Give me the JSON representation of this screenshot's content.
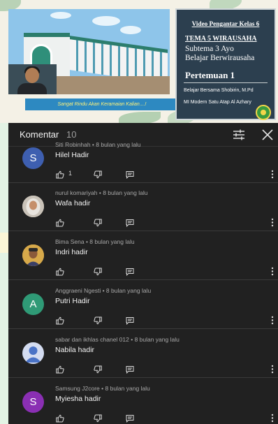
{
  "video": {
    "caption": "Sangat Rindu Akan Keramaian Kalian....!",
    "slide": {
      "title": "Video Pengantar Kelas 6",
      "tema": "TEMA 5 WIRAUSAHA",
      "subtema_line1": "Subtema 3 Ayo",
      "subtema_line2": "Belajar Berwirausaha",
      "pertemuan": "Pertemuan 1",
      "by": "Belajar Bersama Shobirin, M.Pd",
      "school": "MI Modern Satu Atap Al Azhary"
    }
  },
  "panel": {
    "title": "Komentar",
    "count": "10",
    "icons": {
      "filter": "sort-filter-icon",
      "close": "close-icon"
    },
    "colors": {
      "background": "#212121",
      "divider": "#3a3a3a",
      "meta": "#a8a8a8"
    }
  },
  "comments": [
    {
      "author": "Siti Robinhah",
      "time": "8 bulan yang lalu",
      "text": "Hilel Hadir",
      "likes": "1",
      "avatar_letter": "S",
      "avatar_color": "#3e5fb0",
      "avatar_type": "letter"
    },
    {
      "author": "nurul komariyah",
      "time": "8 bulan yang lalu",
      "text": "Wafa hadir",
      "likes": "",
      "avatar_letter": "",
      "avatar_color": "#c9c2b8",
      "avatar_type": "photo-hijab"
    },
    {
      "author": "Bima Sena",
      "time": "8 bulan yang lalu",
      "text": "Indri hadir",
      "likes": "",
      "avatar_letter": "",
      "avatar_color": "#d7a94a",
      "avatar_type": "photo-person"
    },
    {
      "author": "Anggraeni Ngesti",
      "time": "8 bulan yang lalu",
      "text": "Putri Hadir",
      "likes": "",
      "avatar_letter": "A",
      "avatar_color": "#2f9a76",
      "avatar_type": "letter"
    },
    {
      "author": "sabar dan ikhlas chanel 012",
      "time": "8 bulan yang lalu",
      "text": "Nabila hadir",
      "likes": "",
      "avatar_letter": "",
      "avatar_color": "#d4dcf0",
      "avatar_type": "default-user"
    },
    {
      "author": "Samsung J2core",
      "time": "8 bulan yang lalu",
      "text": "Myiesha  hadir",
      "likes": "",
      "avatar_letter": "S",
      "avatar_color": "#8a2fb3",
      "avatar_type": "letter"
    }
  ]
}
